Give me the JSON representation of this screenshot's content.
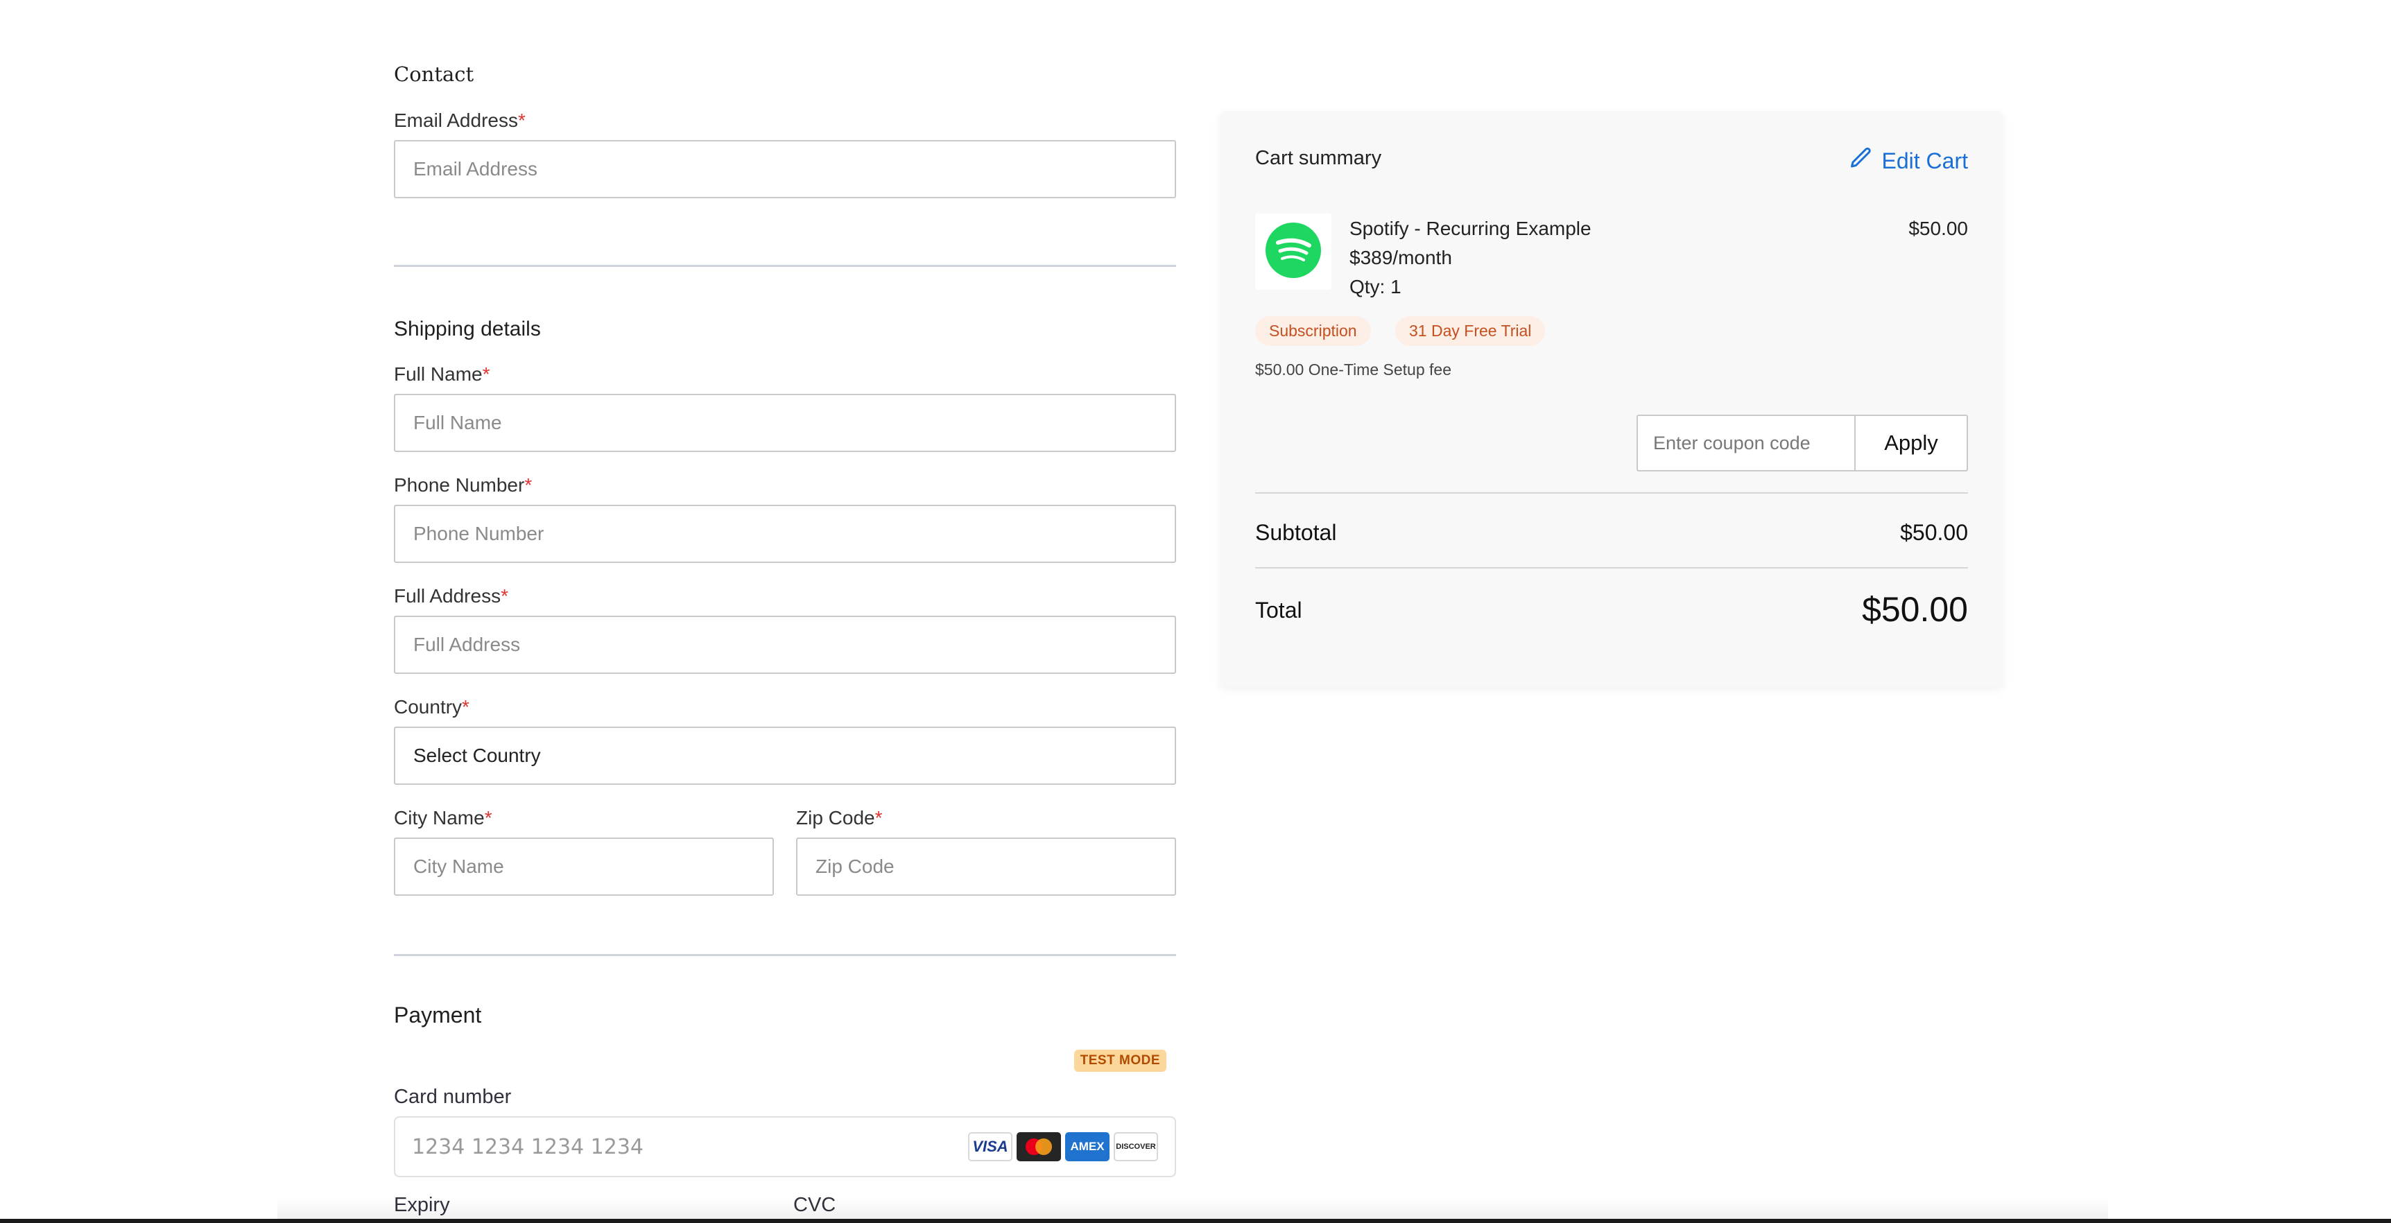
{
  "contact": {
    "title": "Contact",
    "email_label": "Email Address",
    "email_placeholder": "Email Address"
  },
  "shipping": {
    "title": "Shipping details",
    "full_name_label": "Full Name",
    "full_name_placeholder": "Full Name",
    "phone_label": "Phone Number",
    "phone_placeholder": "Phone Number",
    "address_label": "Full Address",
    "address_placeholder": "Full Address",
    "country_label": "Country",
    "country_value": "Select Country",
    "city_label": "City Name",
    "city_placeholder": "City Name",
    "zip_label": "Zip Code",
    "zip_placeholder": "Zip Code"
  },
  "payment": {
    "title": "Payment",
    "test_mode": "TEST MODE",
    "card_label": "Card number",
    "card_placeholder": "1234 1234 1234 1234",
    "card_brands": [
      "VISA",
      "mastercard",
      "AMEX",
      "DISCOVER"
    ],
    "expiry_label": "Expiry",
    "cvc_label": "CVC"
  },
  "cart": {
    "title": "Cart summary",
    "edit_label": "Edit Cart",
    "product": {
      "name": "Spotify - Recurring Example",
      "price": "$389/month",
      "qty": "Qty: 1",
      "amount": "$50.00",
      "icon": "spotify-logo"
    },
    "tags": [
      "Subscription",
      "31 Day Free Trial"
    ],
    "setup_fee": "$50.00 One-Time Setup fee",
    "coupon_placeholder": "Enter coupon code",
    "apply_label": "Apply",
    "subtotal_label": "Subtotal",
    "subtotal_value": "$50.00",
    "total_label": "Total",
    "total_value": "$50.00"
  },
  "colors": {
    "accent": "#1a6fd6",
    "required": "#e0342f",
    "tag_bg": "#fdeee6",
    "tag_text": "#c5501f",
    "test_badge_bg": "#fcd79b",
    "spotify_green": "#1ed760"
  }
}
